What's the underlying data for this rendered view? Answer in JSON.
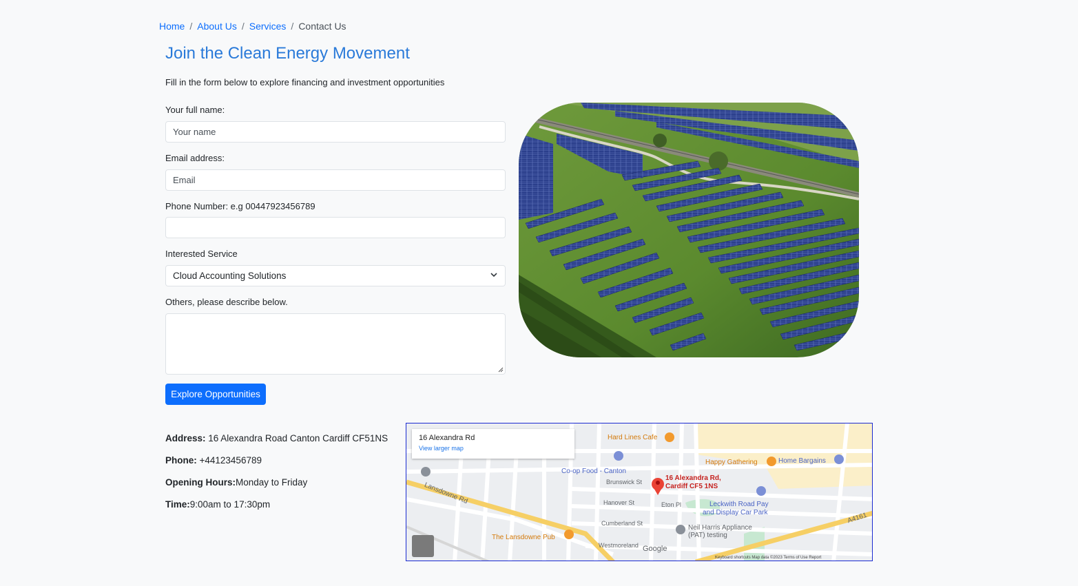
{
  "breadcrumb": {
    "items": [
      "Home",
      "About Us",
      "Services"
    ],
    "current": "Contact Us"
  },
  "page": {
    "title": "Join the Clean Energy Movement",
    "subtitle": "Fill in the form below to explore financing and investment opportunities"
  },
  "form": {
    "name_label": "Your full name:",
    "name_placeholder": "Your name",
    "email_label": "Email address:",
    "email_placeholder": "Email",
    "phone_label": "Phone Number: e.g 00447923456789",
    "phone_placeholder": "",
    "service_label": "Interested Service",
    "service_selected": "Cloud Accounting Solutions",
    "others_label": "Others, please describe below.",
    "submit_label": "Explore Opportunities"
  },
  "contact": {
    "address_label": "Address:",
    "address_value": " 16 Alexandra Road Canton Cardiff CF51NS",
    "phone_label": "Phone:",
    "phone_value": " +44123456789",
    "hours_label": "Opening Hours:",
    "hours_value": "Monday to Friday",
    "time_label": "Time:",
    "time_value": "9:00am to 17:30pm"
  },
  "map": {
    "card_title": "16 Alexandra Rd",
    "card_link": "View larger map",
    "pin_label_1": "16 Alexandra Rd,",
    "pin_label_2": "Cardiff CF5 1NS",
    "labels": {
      "hard_lines": "Hard Lines Cafe",
      "coop": "Co-op Food - Canton",
      "happy": "Happy Gathering",
      "home_bargains": "Home Bargains",
      "leckwith1": "Leckwith Road Pay",
      "leckwith2": "and Display Car Park",
      "neil1": "Neil Harris Appliance",
      "neil2": "(PAT) testing",
      "lansdowne_pub": "The Lansdowne Pub",
      "lansdowne_rd": "Lansdowne Rd",
      "brunswick": "Brunswick St",
      "hanover": "Hanover St",
      "cumberland": "Cumberland St",
      "westmoreland": "Westmoreland",
      "eton": "Eton Pl",
      "a4161": "A4161",
      "google": "Google",
      "footer": "Keyboard shortcuts   Map data ©2023   Terms of Use   Report"
    }
  }
}
